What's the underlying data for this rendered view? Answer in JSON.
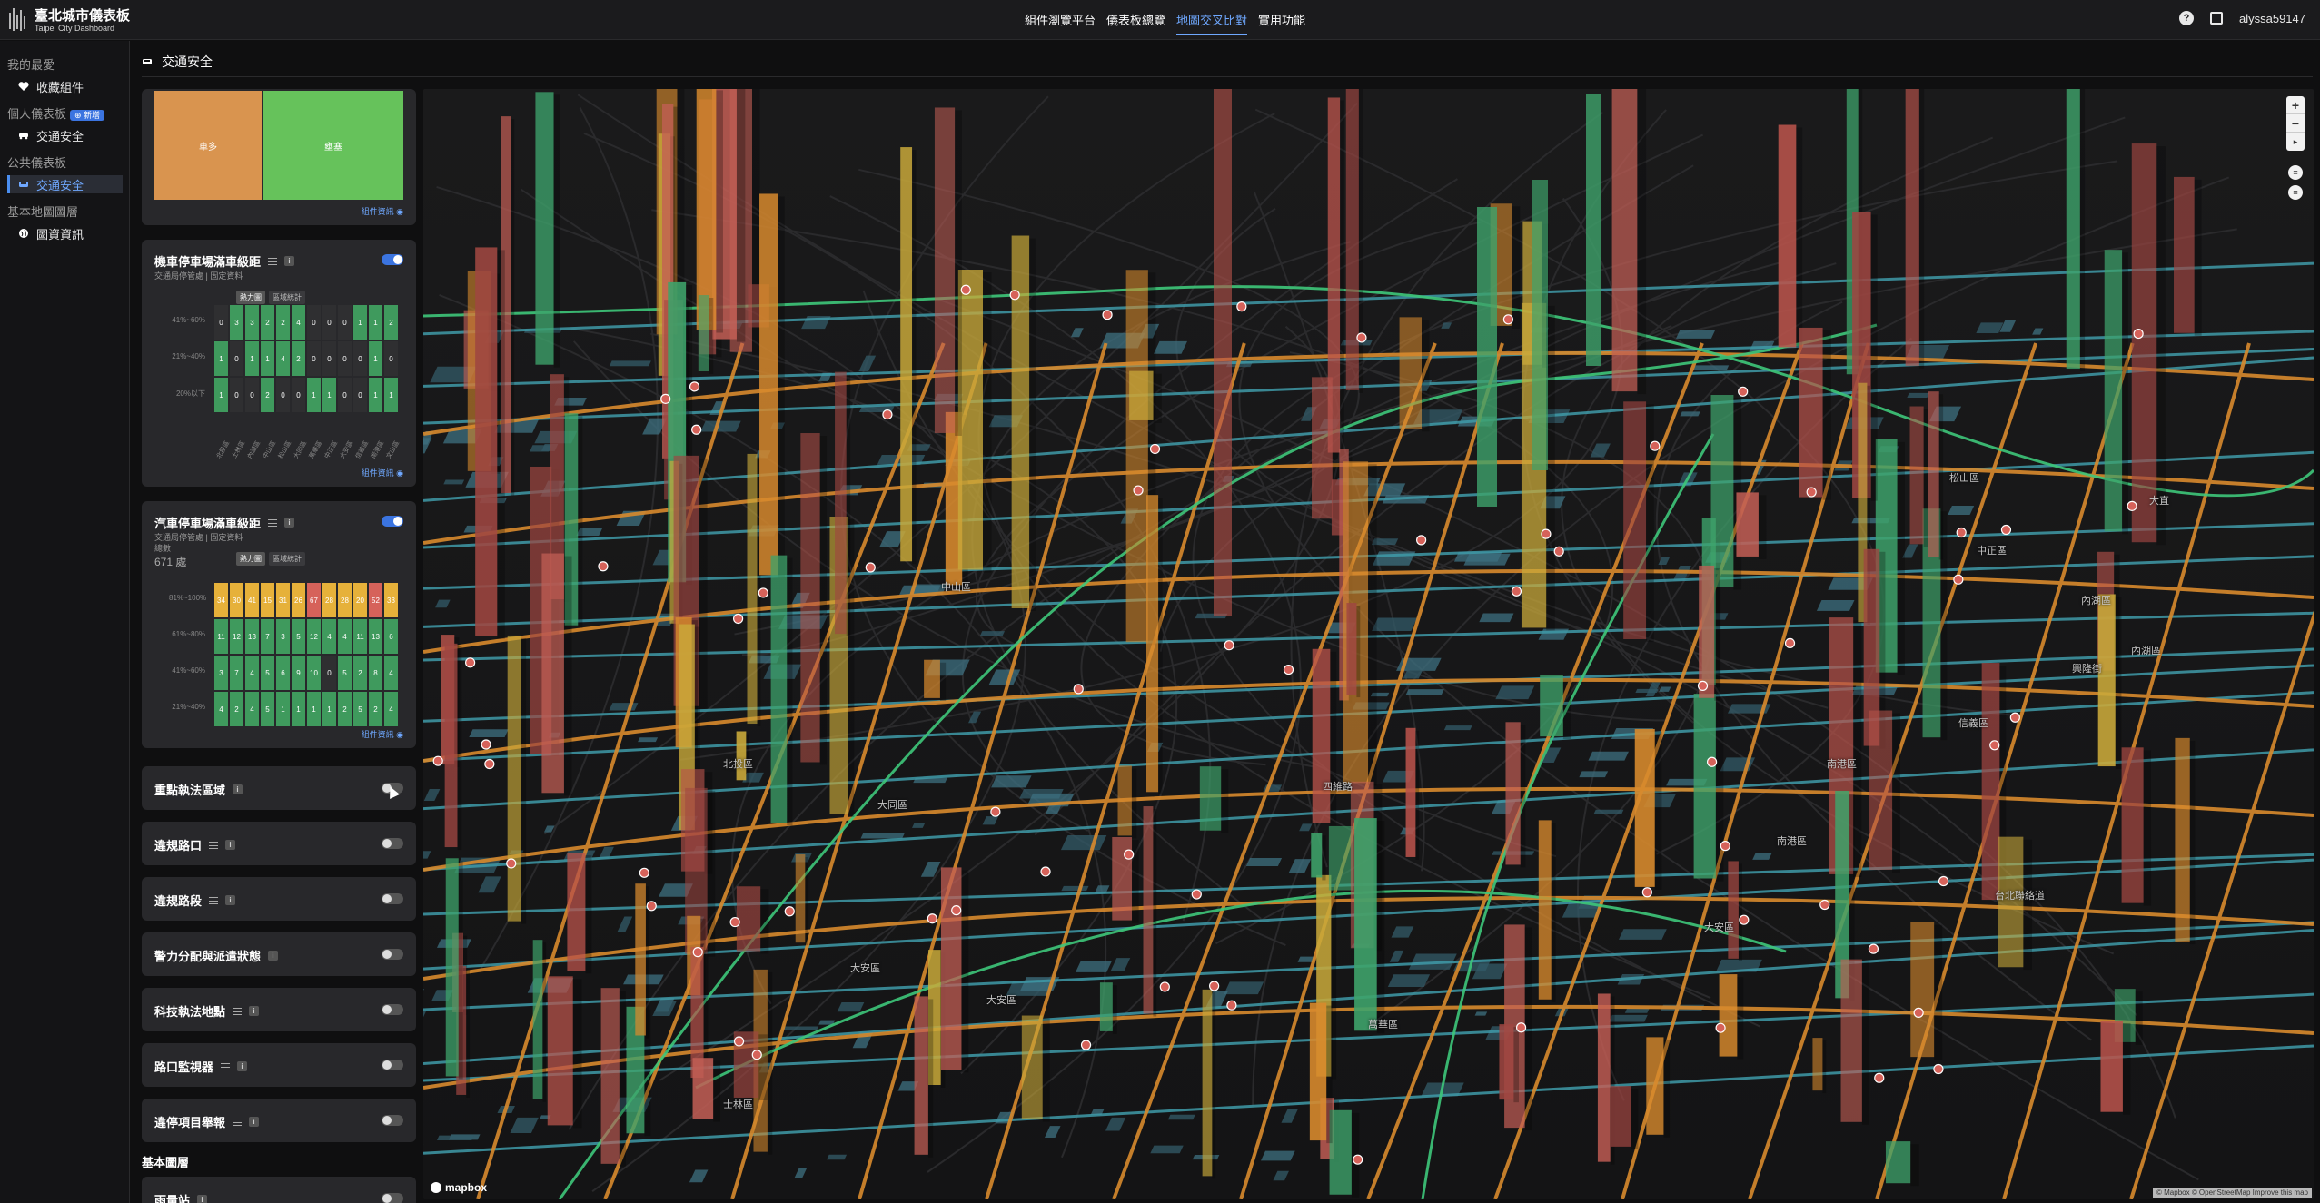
{
  "app": {
    "title": "臺北城市儀表板",
    "subtitle": "Taipei City Dashboard",
    "nav": [
      "組件瀏覽平台",
      "儀表板總覽",
      "地圖交叉比對",
      "實用功能"
    ],
    "nav_active_index": 2,
    "username": "alyssa59147",
    "help_glyph": "?"
  },
  "sidebar": {
    "favorites_header": "我的最愛",
    "favorites_item": "收藏組件",
    "personal_header": "個人儀表板",
    "new_badge": "⊕ 新增",
    "personal_item": "交通安全",
    "public_header": "公共儀表板",
    "public_item": "交通安全",
    "basemap_header": "基本地圖圖層",
    "basemap_item": "圖資資訊"
  },
  "page": {
    "title": "交通安全"
  },
  "components": {
    "treemap": {
      "label_a": "車多",
      "label_b": "壅塞",
      "footer": "組件資訊 ◉"
    },
    "moto": {
      "title": "機車停車場滿車級距",
      "sub": "交通局停管處 | 固定資料",
      "tabs": [
        "熱力圖",
        "區域統計"
      ],
      "rows": [
        "41%~60%",
        "21%~40%",
        "20%以下"
      ],
      "cells": [
        [
          "0",
          "3",
          "3",
          "2",
          "2",
          "4",
          "0",
          "0",
          "0",
          "1",
          "1",
          "2"
        ],
        [
          "1",
          "0",
          "1",
          "1",
          "4",
          "2",
          "0",
          "0",
          "0",
          "0",
          "1",
          "0"
        ],
        [
          "1",
          "0",
          "0",
          "2",
          "0",
          "0",
          "1",
          "1",
          "0",
          "0",
          "1",
          "1"
        ]
      ],
      "cols": [
        "北投區",
        "士林區",
        "內湖區",
        "中山區",
        "松山區",
        "大同區",
        "萬華區",
        "中正區",
        "大安區",
        "信義區",
        "南港區",
        "文山區"
      ],
      "footer": "組件資訊 ◉"
    },
    "car": {
      "title": "汽車停車場滿車級距",
      "sub": "交通局停管處 | 固定資料",
      "sub2": "總數",
      "total": "671 處",
      "tabs": [
        "熱力圖",
        "區域統計"
      ],
      "rows": [
        "81%~100%",
        "61%~80%",
        "41%~60%",
        "21%~40%"
      ],
      "cells": [
        [
          "34",
          "30",
          "41",
          "15",
          "31",
          "26",
          "67",
          "28",
          "28",
          "20",
          "52",
          "33"
        ],
        [
          "11",
          "12",
          "13",
          "7",
          "3",
          "5",
          "12",
          "4",
          "4",
          "11",
          "13",
          "6"
        ],
        [
          "3",
          "7",
          "4",
          "5",
          "6",
          "9",
          "10",
          "0",
          "5",
          "2",
          "8",
          "4"
        ],
        [
          "4",
          "2",
          "4",
          "5",
          "1",
          "1",
          "1",
          "1",
          "2",
          "5",
          "2",
          "4"
        ]
      ],
      "footer": "組件資訊 ◉"
    },
    "toggles": [
      {
        "name": "重點執法區域",
        "has_list": false
      },
      {
        "name": "違規路口",
        "has_list": true
      },
      {
        "name": "違規路段",
        "has_list": true
      },
      {
        "name": "警力分配與派遣狀態",
        "has_list": false
      },
      {
        "name": "科技執法地點",
        "has_list": true
      },
      {
        "name": "路口監視器",
        "has_list": true
      },
      {
        "name": "違停項目舉報",
        "has_list": true
      }
    ],
    "basemap_section": "基本圖層",
    "basemap_first": "雨量站"
  },
  "map": {
    "zoom_in": "+",
    "zoom_out": "−",
    "compass": "▸",
    "attribution": "© Mapbox © OpenStreetMap Improve this map",
    "mapbox": "mapbox",
    "labels": [
      "大安區",
      "大安區",
      "大安區",
      "台北聯絡道",
      "信義區",
      "南港區",
      "內湖區",
      "內湖區",
      "中山區",
      "大同區",
      "萬華區",
      "北投區",
      "士林區",
      "松山區",
      "大直",
      "中正區",
      "興隆街",
      "南港區",
      "四維路"
    ]
  }
}
